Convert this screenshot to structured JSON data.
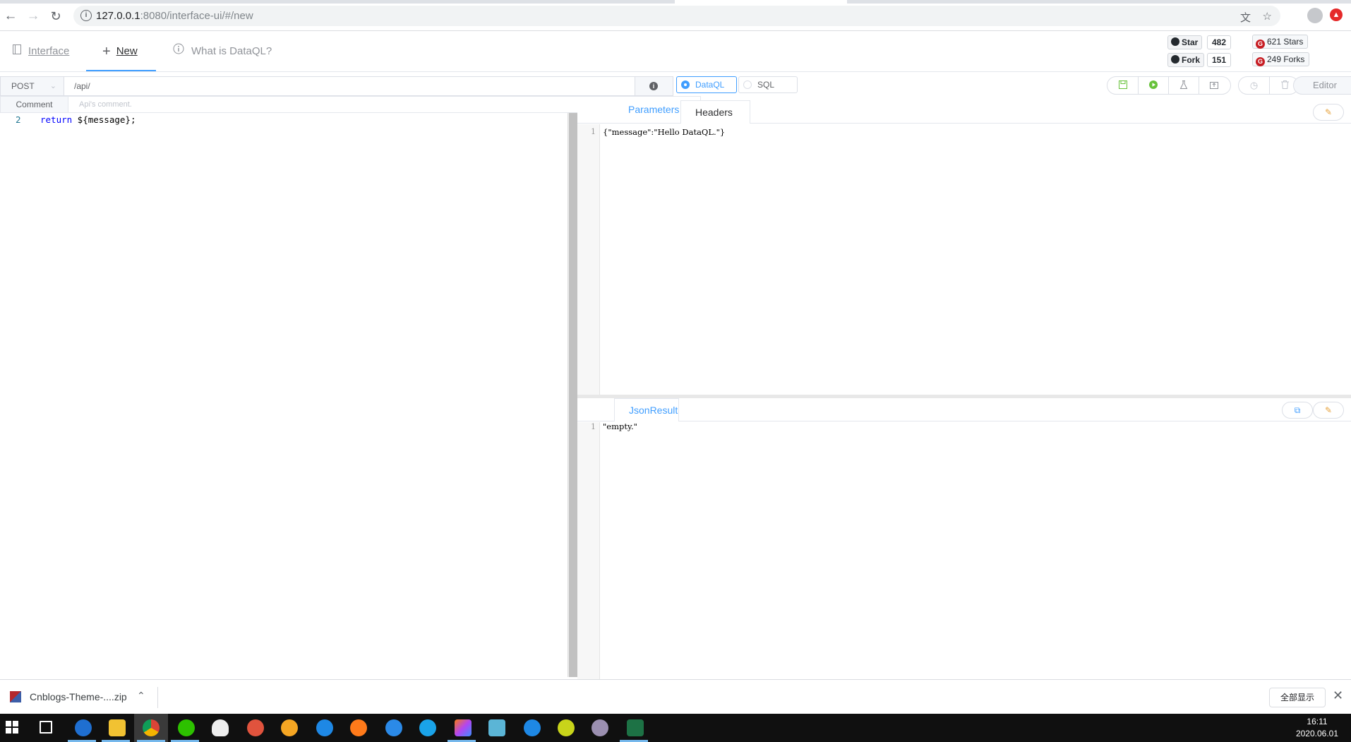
{
  "browser": {
    "url_host": "127.0.0.1",
    "url_path": ":8080/interface-ui/#/new"
  },
  "header": {
    "menu": [
      {
        "label": "Interface",
        "icon": "document-icon"
      },
      {
        "label": "New",
        "icon": "plus-icon"
      },
      {
        "label": "What is DataQL?",
        "icon": "info-circle-icon"
      }
    ],
    "github": {
      "star_label": "Star",
      "star_count": "482",
      "fork_label": "Fork",
      "fork_count": "151"
    },
    "gitee": {
      "stars": "621 Stars",
      "forks": "249 Forks"
    }
  },
  "request": {
    "method": "POST",
    "path": "/api/",
    "comment_label": "Comment",
    "comment_placeholder": "Api's comment."
  },
  "mode": {
    "options": [
      "DataQL",
      "SQL"
    ],
    "selected": "DataQL"
  },
  "toolbar": {
    "editor_label": "Editor",
    "buttons": [
      "save-icon",
      "run-icon",
      "test-icon",
      "publish-icon",
      "history-icon",
      "delete-icon"
    ]
  },
  "editor": {
    "line_number": "2",
    "keyword": "return",
    "rest": " ${message};"
  },
  "params_panel": {
    "tabs": [
      "Parameters",
      "Headers"
    ],
    "active_tab": "Parameters",
    "line": "1",
    "content": "{\"message\":\"Hello DataQL.\"}"
  },
  "result_panel": {
    "tabs": [
      "JsonResult"
    ],
    "line": "1",
    "content": "\"empty.\""
  },
  "downloads": {
    "file_name": "Cnblogs-Theme-....zip",
    "show_all": "全部显示"
  },
  "taskbar": {
    "time": "16:11",
    "date": "2020.06.01"
  },
  "colors": {
    "accent": "#409eff",
    "border": "#dcdfe6",
    "warn": "#e6a23c"
  }
}
